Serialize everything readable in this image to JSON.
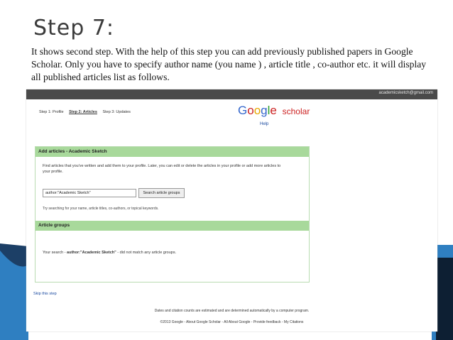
{
  "slide": {
    "title": "Step 7:",
    "paragraph": "It shows second step. With the help of this step you can add previously published papers in Google Scholar. Only you have to specify author name (you name ) , article title , co-author etc. it will display all published articles list as follows."
  },
  "screenshot": {
    "account_email": "academicsketch@gmail.com",
    "steps": [
      "Step 1: Profile",
      "Step 2: Articles",
      "Step 3: Updates"
    ],
    "logo_google": "Google",
    "logo_scholar": "scholar",
    "help_link": "Help",
    "add_panel": {
      "title": "Add articles - Academic Sketch",
      "description": "Find articles that you've written and add them to your profile. Later, you can edit or delete the articles in your profile or add more articles to your profile.",
      "search_value": "author:\"Academic Sketch\"",
      "search_button": "Search article groups",
      "hint": "Try searching for your name, article titles, co-authors, or topical keywords."
    },
    "groups_panel": {
      "title": "Article groups",
      "result_prefix": "Your search - ",
      "result_query": "author:\"Academic Sketch\"",
      "result_suffix": " - did not match any article groups."
    },
    "skip_link": "Skip this step",
    "footer_note": "Dates and citation counts are estimated and are determined automatically by a computer program.",
    "footer_links": "©2013 Google - About Google Scholar - All About Google - Provide feedback - My Citations"
  },
  "colors": {
    "panel_header": "#a8d99b",
    "topbar": "#4a4a4a",
    "deco_blue": "#2f7fc1",
    "deco_dark": "#1c3f66"
  }
}
